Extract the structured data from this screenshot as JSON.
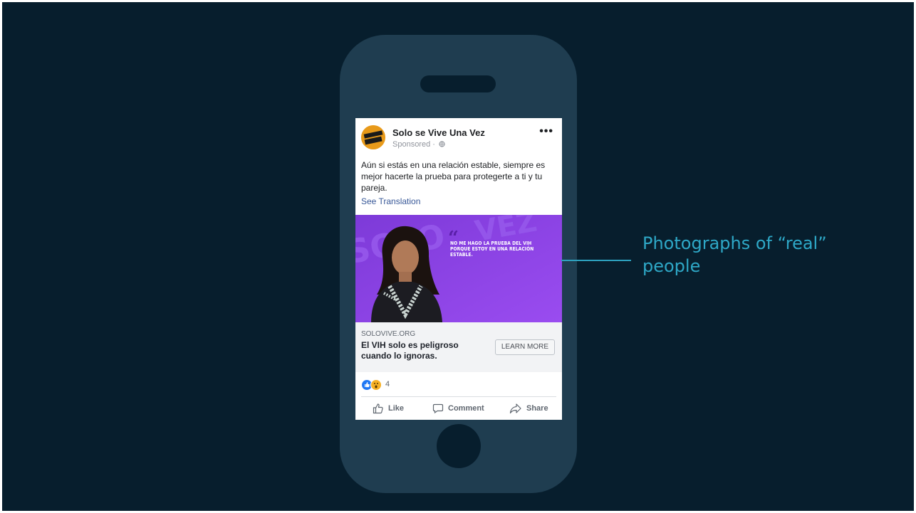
{
  "post": {
    "page_name": "Solo se Vive Una Vez",
    "sponsored": "Sponsored · ",
    "text": "Aún si estás en una relación estable, siempre es mejor hacerte la prueba para protegerte a ti y tu pareja.",
    "see_translation": "See Translation",
    "image": {
      "quote": "NO ME HAGO LA PRUEBA DEL VIH PORQUE ESTOY EN UNA RELACIÓN ESTABLE.",
      "quote_mark": "“"
    },
    "link": {
      "domain": "SOLOVIVE.ORG",
      "headline": "El VIH solo es peligroso cuando lo ignoras.",
      "cta": "LEARN MORE"
    },
    "reaction_count": "4",
    "actions": {
      "like": "Like",
      "comment": "Comment",
      "share": "Share"
    }
  },
  "callout": {
    "text": "Photographs of “real” people"
  },
  "icons": [
    "globe-icon",
    "more-icon",
    "like-icon",
    "comment-icon",
    "share-icon"
  ],
  "colors": {
    "background": "#071e2d",
    "phone": "#1f3d50",
    "callout": "#2ea8c7",
    "ad_purple": "#8a3fe0",
    "link_blue": "#385898"
  }
}
